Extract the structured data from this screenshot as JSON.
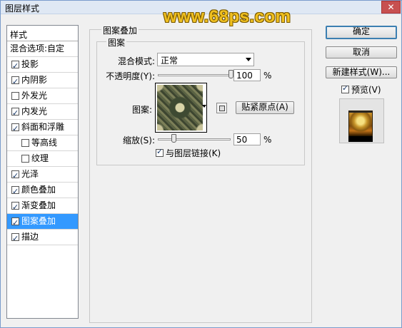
{
  "window": {
    "title": "图层样式",
    "watermark": "www.68ps.com",
    "close": "✕"
  },
  "styles_panel": {
    "header": "样式",
    "items": [
      {
        "label": "混合选项:自定",
        "has_checkbox": false,
        "checked": false
      },
      {
        "label": "投影",
        "has_checkbox": true,
        "checked": true
      },
      {
        "label": "内阴影",
        "has_checkbox": true,
        "checked": true
      },
      {
        "label": "外发光",
        "has_checkbox": true,
        "checked": false
      },
      {
        "label": "内发光",
        "has_checkbox": true,
        "checked": true
      },
      {
        "label": "斜面和浮雕",
        "has_checkbox": true,
        "checked": true
      },
      {
        "label": "等高线",
        "has_checkbox": true,
        "checked": false
      },
      {
        "label": "纹理",
        "has_checkbox": true,
        "checked": false
      },
      {
        "label": "光泽",
        "has_checkbox": true,
        "checked": true
      },
      {
        "label": "颜色叠加",
        "has_checkbox": true,
        "checked": true
      },
      {
        "label": "渐变叠加",
        "has_checkbox": true,
        "checked": true
      },
      {
        "label": "图案叠加",
        "has_checkbox": true,
        "checked": true,
        "selected": true
      },
      {
        "label": "描边",
        "has_checkbox": true,
        "checked": true
      }
    ]
  },
  "pattern_overlay": {
    "group_title": "图案叠加",
    "subgroup_title": "图案",
    "blend_mode_label": "混合模式:",
    "blend_mode_value": "正常",
    "opacity_label": "不透明度(Y):",
    "opacity_value": "100",
    "opacity_fraction": 1.0,
    "pattern_label": "图案:",
    "snap_origin_label": "贴紧原点(A)",
    "scale_label": "缩放(S):",
    "scale_value": "50",
    "scale_fraction": 0.05,
    "percent": "%",
    "link_label": "与图层链接(K)",
    "link_checked": true
  },
  "buttons": {
    "ok": "确定",
    "cancel": "取消",
    "new_style": "新建样式(W)...",
    "preview_label": "预览(V)",
    "preview_checked": true
  }
}
